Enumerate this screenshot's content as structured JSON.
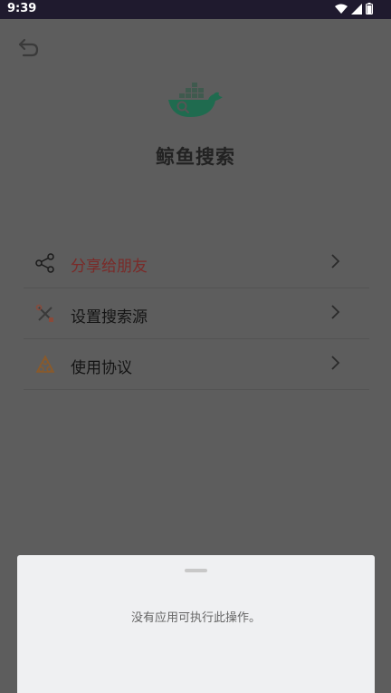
{
  "status": {
    "time": "9:39"
  },
  "app": {
    "title": "鲸鱼搜索"
  },
  "menu": [
    {
      "label": "分享给朋友",
      "icon": "share-icon"
    },
    {
      "label": "设置搜索源",
      "icon": "tools-icon"
    },
    {
      "label": "使用协议",
      "icon": "agreement-icon"
    }
  ],
  "sheet": {
    "message": "没有应用可执行此操作。"
  },
  "colors": {
    "share_accent": "#7a2a28",
    "whale_green": "#1f6b4f",
    "sheet_bg": "#eff0f2"
  }
}
